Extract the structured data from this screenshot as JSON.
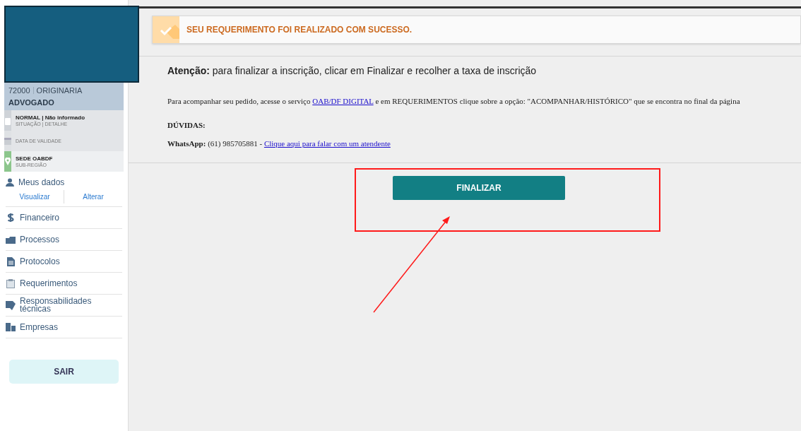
{
  "profile": {
    "number": "72000",
    "type": "ORIGINARIA",
    "role": "ADVOGADO"
  },
  "info_rows": [
    {
      "kind": "status",
      "title": "NORMAL | Não informado",
      "subtitle": "SITUAÇÃO | DETALHE"
    },
    {
      "kind": "date",
      "title": "",
      "subtitle": "DATA DE VALIDADE"
    },
    {
      "kind": "location",
      "title": "SEDE OABDF",
      "subtitle": "SUB-REGIÃO"
    }
  ],
  "menu": {
    "my_data": {
      "label": "Meus dados",
      "links": [
        "Visualizar",
        "Alterar"
      ]
    },
    "items": [
      {
        "kind": "money",
        "label": "Financeiro"
      },
      {
        "kind": "folder",
        "label": "Processos"
      },
      {
        "kind": "doc",
        "label": "Protocolos"
      },
      {
        "kind": "clipboard",
        "label": "Requerimentos"
      },
      {
        "kind": "badge",
        "label": "Responsabilidades técnicas"
      },
      {
        "kind": "building",
        "label": "Empresas"
      }
    ]
  },
  "logout_button": "SAIR",
  "success_alert": "SEU REQUERIMENTO FOI REALIZADO COM SUCESSO.",
  "notice": {
    "heading": "**Atenção:** para finalizar a inscrição, clicar em Finalizar e recolher a taxa de inscrição",
    "follow_text_before": "Para acompanhar seu pedido, acesse o serviço",
    "follow_link": "OAB/DF DIGITAL",
    "follow_text_after": "e em REQUERIMENTOS clique sobre a opção: \"ACOMPANHAR/HISTÓRICO\" que se encontra no final da página",
    "questions": "DÚVIDAS:",
    "whatsapp_text": "**WhatsApp:** (61) 985705881 -",
    "whatsapp_link": "Clique aqui para falar com um atendente"
  },
  "finalize_button": "FINALIZAR"
}
